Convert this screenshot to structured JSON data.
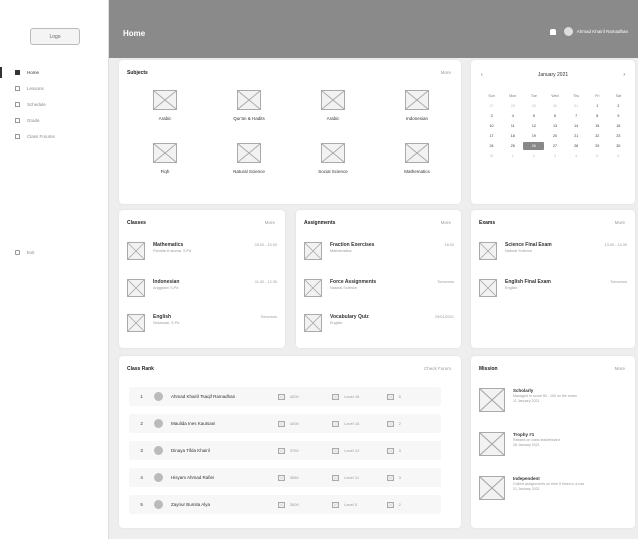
{
  "sidebar": {
    "logo": "Logo",
    "items": [
      {
        "label": "Home",
        "icon": "grid-icon",
        "active": true
      },
      {
        "label": "Lessons",
        "icon": "book-icon"
      },
      {
        "label": "Schedule",
        "icon": "calendar-icon"
      },
      {
        "label": "Grade",
        "icon": "document-icon"
      },
      {
        "label": "Class Forums",
        "icon": "chat-icon"
      }
    ],
    "exit": "Exit"
  },
  "header": {
    "title": "Home",
    "user": "Ahmad Khairil Ramadhan"
  },
  "subjects": {
    "title": "Subjects",
    "more": "More",
    "items": [
      "Arabic",
      "Qur'an & Hadits",
      "Arabic",
      "Indonesian",
      "Fiqh",
      "Natural Science",
      "Social Science",
      "Mathematics"
    ]
  },
  "calendar": {
    "month": "January 2021",
    "days": [
      "Sun",
      "Mon",
      "Tue",
      "Wed",
      "Thu",
      "Fri",
      "Sat"
    ],
    "cells": [
      "27",
      "28",
      "29",
      "30",
      "31",
      "1",
      "2",
      "3",
      "4",
      "5",
      "6",
      "7",
      "8",
      "9",
      "10",
      "11",
      "12",
      "13",
      "14",
      "15",
      "16",
      "17",
      "18",
      "19",
      "20",
      "21",
      "22",
      "23",
      "24",
      "25",
      "26",
      "27",
      "28",
      "29",
      "30",
      "31",
      "1",
      "2",
      "3",
      "4",
      "5",
      "6"
    ],
    "selected": "27"
  },
  "classes": {
    "title": "Classes",
    "more": "More",
    "items": [
      {
        "name": "Mathematics",
        "sub": "Pandita Kusuma, S.Pd",
        "time": "03.00 - 10.00"
      },
      {
        "name": "Indonesian",
        "sub": "Anggraini S.Pd",
        "time": "11.00 - 12.30"
      },
      {
        "name": "English",
        "sub": "Sekarsari, S.Pd",
        "time": "Tomorrow"
      }
    ]
  },
  "assignments": {
    "title": "Assignments",
    "more": "More",
    "items": [
      {
        "name": "Fraction Exercises",
        "sub": "Mathematics",
        "time": "18.00"
      },
      {
        "name": "Force Assignments",
        "sub": "Natural Science",
        "time": "Tomorrow"
      },
      {
        "name": "Vocabulary Quiz",
        "sub": "English",
        "time": "29/01/2021"
      }
    ]
  },
  "exams": {
    "title": "Exams",
    "more": "More",
    "items": [
      {
        "name": "Science Final Exam",
        "sub": "Natural Science",
        "time": "13.00 - 14.30"
      },
      {
        "name": "English Final Exam",
        "sub": "English",
        "time": "Tomorrow"
      }
    ]
  },
  "rank": {
    "title": "Class Rank",
    "more": "Check Forum",
    "rows": [
      {
        "n": "1",
        "name": "Ahmad Khairil Tsaqif Ramadhan",
        "xp": "4200",
        "level": "Level 16",
        "badge": "5"
      },
      {
        "n": "2",
        "name": "Maulida Ines Kautsani",
        "xp": "4200",
        "level": "Level 16",
        "badge": "2"
      },
      {
        "n": "3",
        "name": "Dinaya Tifda Khairil",
        "xp": "3750",
        "level": "Level 12",
        "badge": "3"
      },
      {
        "n": "4",
        "name": "Hisyam Ahmad Rafiei",
        "xp": "3080",
        "level": "Level 11",
        "badge": "3"
      },
      {
        "n": "5",
        "name": "Zaynur Bumita Alya",
        "xp": "3000",
        "level": "Level 5",
        "badge": "2"
      }
    ]
  },
  "mission": {
    "title": "Mission",
    "more": "More",
    "items": [
      {
        "name": "Scholarly",
        "sub": "Managed to score 90 - 100 on the exam",
        "date": "11 January 2021"
      },
      {
        "name": "Trophy #1",
        "sub": "Ranked on class leaderboard",
        "date": "26 January 2021"
      },
      {
        "name": "Independent",
        "sub": "Collect assignments on time 5 times in a row",
        "date": "21 January 2021"
      }
    ]
  }
}
